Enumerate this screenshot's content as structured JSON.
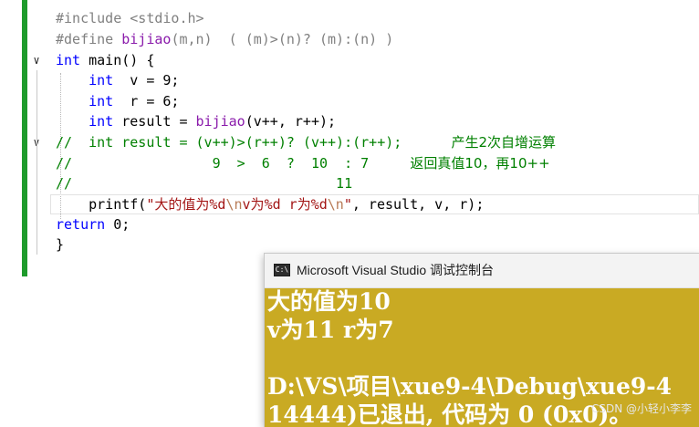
{
  "editor": {
    "lines": [
      {
        "id": "l1",
        "parts": [
          {
            "t": "#include <stdio.h>",
            "c": "pp"
          }
        ]
      },
      {
        "id": "l2",
        "parts": [
          {
            "t": "#define ",
            "c": "pp"
          },
          {
            "t": "bijiao",
            "c": "mac"
          },
          {
            "t": "(m,n)  ( (m)>(n)? (m):(n) )",
            "c": "prm"
          }
        ]
      },
      {
        "id": "l3",
        "parts": [
          {
            "t": "int",
            "c": "kw"
          },
          {
            "t": " main() {",
            "c": "id"
          }
        ]
      },
      {
        "id": "l4",
        "parts": [
          {
            "t": "    int",
            "c": "kw"
          },
          {
            "t": "  v = 9;",
            "c": "id"
          }
        ]
      },
      {
        "id": "l5",
        "parts": [
          {
            "t": "    int",
            "c": "kw"
          },
          {
            "t": "  r = 6;",
            "c": "id"
          }
        ]
      },
      {
        "id": "l6",
        "parts": [
          {
            "t": "    int",
            "c": "kw"
          },
          {
            "t": " result = ",
            "c": "id"
          },
          {
            "t": "bijiao",
            "c": "mac"
          },
          {
            "t": "(v++, r++);",
            "c": "id"
          }
        ]
      },
      {
        "id": "l7",
        "parts": [
          {
            "t": "//  int result = (v++)>(r++)? (v++):(r++);      ",
            "c": "cm"
          },
          {
            "t": "产生2次自增运算",
            "c": "cm-cjk"
          }
        ]
      },
      {
        "id": "l8",
        "parts": [
          {
            "t": "//                 9  >  6  ?  10  : 7     ",
            "c": "cm"
          },
          {
            "t": "返回真值10，再10++",
            "c": "cm-cjk"
          }
        ]
      },
      {
        "id": "l9",
        "parts": [
          {
            "t": "//                                11",
            "c": "cm"
          }
        ]
      },
      {
        "id": "l10",
        "parts": [
          {
            "t": "    printf(",
            "c": "id"
          },
          {
            "t": "\"",
            "c": "str"
          },
          {
            "t": "大的值为",
            "c": "str-cjk"
          },
          {
            "t": "%d",
            "c": "str"
          },
          {
            "t": "\\n",
            "c": "esc"
          },
          {
            "t": "v",
            "c": "str"
          },
          {
            "t": "为",
            "c": "str-cjk"
          },
          {
            "t": "%d r",
            "c": "str"
          },
          {
            "t": "为",
            "c": "str-cjk"
          },
          {
            "t": "%d",
            "c": "str"
          },
          {
            "t": "\\n",
            "c": "esc"
          },
          {
            "t": "\"",
            "c": "str"
          },
          {
            "t": ", result, v, r);",
            "c": "id"
          }
        ]
      },
      {
        "id": "l11",
        "parts": [
          {
            "t": "return",
            "c": "kw"
          },
          {
            "t": " 0;",
            "c": "id"
          }
        ]
      },
      {
        "id": "l12",
        "parts": [
          {
            "t": "}",
            "c": "id"
          }
        ]
      }
    ],
    "fold_glyph": "∨"
  },
  "console": {
    "title": "Microsoft Visual Studio 调试控制台",
    "icon_text": "C:\\",
    "lines": [
      "大的值为10",
      "v为11 r为7",
      "",
      "D:\\VS\\项目\\xue9-4\\Debug\\xue9-4",
      "14444)已退出, 代码为 0 (0x0)。"
    ],
    "background": "#c9aa23",
    "text_color": "#ffffff"
  },
  "watermark": "CSDN @小轻小李李",
  "colors": {
    "change_bar": "#1e9b2b",
    "keyword": "#0000ff",
    "comment": "#008000",
    "string": "#a31515",
    "macro": "#8a1bab"
  }
}
